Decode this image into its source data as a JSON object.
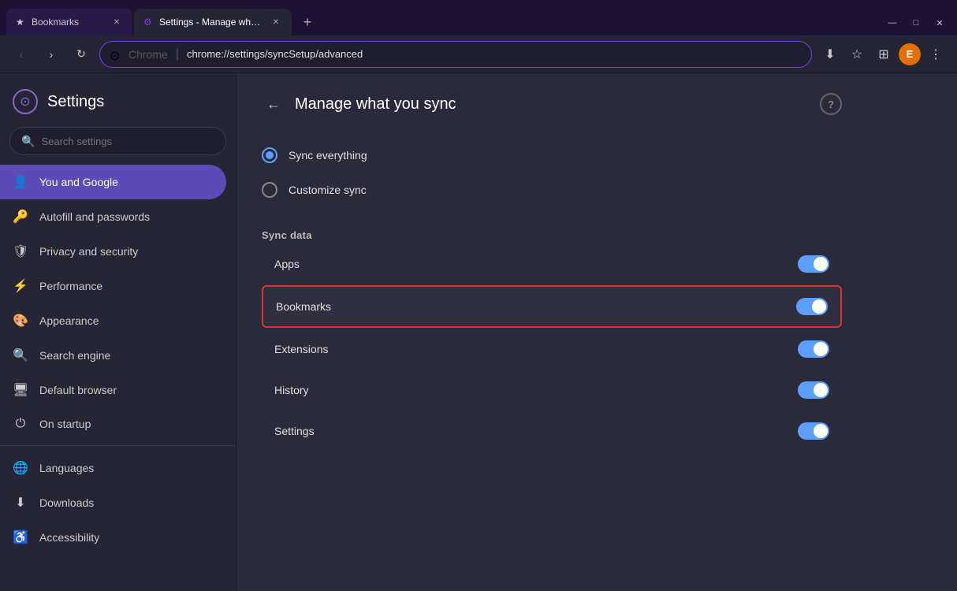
{
  "browser": {
    "tabs": [
      {
        "id": "tab-bookmarks",
        "label": "Bookmarks",
        "favicon": "★",
        "active": false
      },
      {
        "id": "tab-settings",
        "label": "Settings - Manage what you sync",
        "favicon": "⚙",
        "active": true
      }
    ],
    "new_tab_label": "+",
    "window_controls": {
      "minimize": "—",
      "maximize": "□",
      "close": "✕"
    },
    "address_bar": {
      "favicon": "●",
      "divider": "Chrome",
      "url": "chrome://settings/syncSetup/advanced"
    },
    "toolbar_icons": {
      "back": "‹",
      "forward": "›",
      "reload": "↻",
      "bookmark": "☆",
      "extensions": "□",
      "menu": "⋮",
      "profile_initial": "E"
    }
  },
  "sidebar": {
    "logo": "◎",
    "title": "Settings",
    "search_placeholder": "Search settings",
    "items": [
      {
        "id": "you-and-google",
        "icon": "👤",
        "label": "You and Google",
        "active": true
      },
      {
        "id": "autofill",
        "icon": "🔑",
        "label": "Autofill and passwords",
        "active": false
      },
      {
        "id": "privacy",
        "icon": "🛡",
        "label": "Privacy and security",
        "active": false
      },
      {
        "id": "performance",
        "icon": "⚡",
        "label": "Performance",
        "active": false
      },
      {
        "id": "appearance",
        "icon": "🎨",
        "label": "Appearance",
        "active": false
      },
      {
        "id": "search-engine",
        "icon": "🔍",
        "label": "Search engine",
        "active": false
      },
      {
        "id": "default-browser",
        "icon": "🖥",
        "label": "Default browser",
        "active": false
      },
      {
        "id": "on-startup",
        "icon": "⏻",
        "label": "On startup",
        "active": false
      },
      {
        "id": "languages",
        "icon": "🌐",
        "label": "Languages",
        "active": false
      },
      {
        "id": "downloads",
        "icon": "⬇",
        "label": "Downloads",
        "active": false
      },
      {
        "id": "accessibility",
        "icon": "♿",
        "label": "Accessibility",
        "active": false
      }
    ]
  },
  "main": {
    "back_button": "←",
    "title": "Manage what you sync",
    "help_button": "?",
    "sync_options": [
      {
        "id": "sync-everything",
        "label": "Sync everything",
        "selected": true
      },
      {
        "id": "customize-sync",
        "label": "Customize sync",
        "selected": false
      }
    ],
    "sync_data_section": "Sync data",
    "sync_items": [
      {
        "id": "apps",
        "label": "Apps",
        "enabled": true,
        "highlighted": false
      },
      {
        "id": "bookmarks",
        "label": "Bookmarks",
        "enabled": true,
        "highlighted": true
      },
      {
        "id": "extensions",
        "label": "Extensions",
        "enabled": true,
        "highlighted": false
      },
      {
        "id": "history",
        "label": "History",
        "enabled": true,
        "highlighted": false
      },
      {
        "id": "settings",
        "label": "Settings",
        "enabled": true,
        "highlighted": false
      }
    ]
  }
}
